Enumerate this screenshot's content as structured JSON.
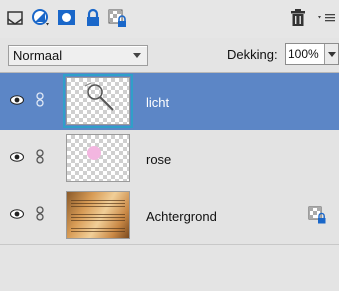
{
  "toolbar": {
    "icons": [
      "new-layer-icon",
      "new-adjustment-layer-icon",
      "add-layer-mask-icon",
      "lock-all-icon",
      "lock-transparency-icon",
      "trash-icon",
      "panel-menu-icon"
    ]
  },
  "options": {
    "blend_mode": "Normaal",
    "opacity_label": "Dekking:",
    "opacity_value": "100%"
  },
  "layers": [
    {
      "name": "licht",
      "selected": true,
      "thumb": "magnifier-brush"
    },
    {
      "name": "rose",
      "selected": false,
      "thumb": "pink-dot"
    },
    {
      "name": "Achtergrond",
      "selected": false,
      "thumb": "sheet-music",
      "locked": true
    }
  ],
  "colors": {
    "selection": "#5c86c6",
    "accent_icons": "#1a67c9",
    "panel_bg": "#e4e4e4"
  }
}
